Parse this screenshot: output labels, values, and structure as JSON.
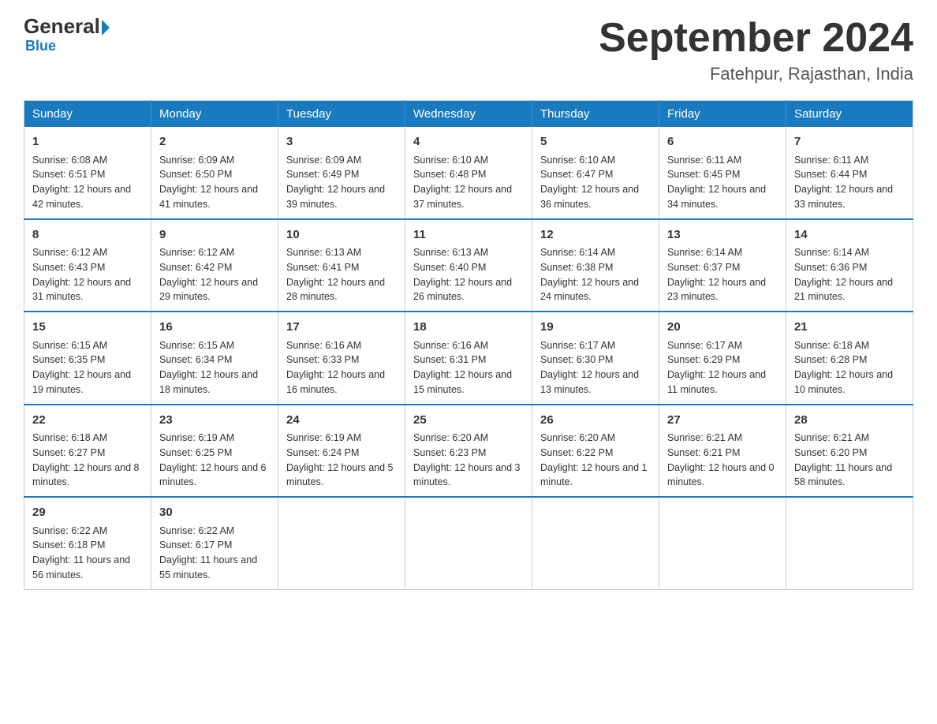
{
  "header": {
    "logo_general": "General",
    "logo_blue": "Blue",
    "month_title": "September 2024",
    "location": "Fatehpur, Rajasthan, India"
  },
  "days_header": [
    "Sunday",
    "Monday",
    "Tuesday",
    "Wednesday",
    "Thursday",
    "Friday",
    "Saturday"
  ],
  "weeks": [
    [
      {
        "day": "1",
        "sunrise": "Sunrise: 6:08 AM",
        "sunset": "Sunset: 6:51 PM",
        "daylight": "Daylight: 12 hours and 42 minutes."
      },
      {
        "day": "2",
        "sunrise": "Sunrise: 6:09 AM",
        "sunset": "Sunset: 6:50 PM",
        "daylight": "Daylight: 12 hours and 41 minutes."
      },
      {
        "day": "3",
        "sunrise": "Sunrise: 6:09 AM",
        "sunset": "Sunset: 6:49 PM",
        "daylight": "Daylight: 12 hours and 39 minutes."
      },
      {
        "day": "4",
        "sunrise": "Sunrise: 6:10 AM",
        "sunset": "Sunset: 6:48 PM",
        "daylight": "Daylight: 12 hours and 37 minutes."
      },
      {
        "day": "5",
        "sunrise": "Sunrise: 6:10 AM",
        "sunset": "Sunset: 6:47 PM",
        "daylight": "Daylight: 12 hours and 36 minutes."
      },
      {
        "day": "6",
        "sunrise": "Sunrise: 6:11 AM",
        "sunset": "Sunset: 6:45 PM",
        "daylight": "Daylight: 12 hours and 34 minutes."
      },
      {
        "day": "7",
        "sunrise": "Sunrise: 6:11 AM",
        "sunset": "Sunset: 6:44 PM",
        "daylight": "Daylight: 12 hours and 33 minutes."
      }
    ],
    [
      {
        "day": "8",
        "sunrise": "Sunrise: 6:12 AM",
        "sunset": "Sunset: 6:43 PM",
        "daylight": "Daylight: 12 hours and 31 minutes."
      },
      {
        "day": "9",
        "sunrise": "Sunrise: 6:12 AM",
        "sunset": "Sunset: 6:42 PM",
        "daylight": "Daylight: 12 hours and 29 minutes."
      },
      {
        "day": "10",
        "sunrise": "Sunrise: 6:13 AM",
        "sunset": "Sunset: 6:41 PM",
        "daylight": "Daylight: 12 hours and 28 minutes."
      },
      {
        "day": "11",
        "sunrise": "Sunrise: 6:13 AM",
        "sunset": "Sunset: 6:40 PM",
        "daylight": "Daylight: 12 hours and 26 minutes."
      },
      {
        "day": "12",
        "sunrise": "Sunrise: 6:14 AM",
        "sunset": "Sunset: 6:38 PM",
        "daylight": "Daylight: 12 hours and 24 minutes."
      },
      {
        "day": "13",
        "sunrise": "Sunrise: 6:14 AM",
        "sunset": "Sunset: 6:37 PM",
        "daylight": "Daylight: 12 hours and 23 minutes."
      },
      {
        "day": "14",
        "sunrise": "Sunrise: 6:14 AM",
        "sunset": "Sunset: 6:36 PM",
        "daylight": "Daylight: 12 hours and 21 minutes."
      }
    ],
    [
      {
        "day": "15",
        "sunrise": "Sunrise: 6:15 AM",
        "sunset": "Sunset: 6:35 PM",
        "daylight": "Daylight: 12 hours and 19 minutes."
      },
      {
        "day": "16",
        "sunrise": "Sunrise: 6:15 AM",
        "sunset": "Sunset: 6:34 PM",
        "daylight": "Daylight: 12 hours and 18 minutes."
      },
      {
        "day": "17",
        "sunrise": "Sunrise: 6:16 AM",
        "sunset": "Sunset: 6:33 PM",
        "daylight": "Daylight: 12 hours and 16 minutes."
      },
      {
        "day": "18",
        "sunrise": "Sunrise: 6:16 AM",
        "sunset": "Sunset: 6:31 PM",
        "daylight": "Daylight: 12 hours and 15 minutes."
      },
      {
        "day": "19",
        "sunrise": "Sunrise: 6:17 AM",
        "sunset": "Sunset: 6:30 PM",
        "daylight": "Daylight: 12 hours and 13 minutes."
      },
      {
        "day": "20",
        "sunrise": "Sunrise: 6:17 AM",
        "sunset": "Sunset: 6:29 PM",
        "daylight": "Daylight: 12 hours and 11 minutes."
      },
      {
        "day": "21",
        "sunrise": "Sunrise: 6:18 AM",
        "sunset": "Sunset: 6:28 PM",
        "daylight": "Daylight: 12 hours and 10 minutes."
      }
    ],
    [
      {
        "day": "22",
        "sunrise": "Sunrise: 6:18 AM",
        "sunset": "Sunset: 6:27 PM",
        "daylight": "Daylight: 12 hours and 8 minutes."
      },
      {
        "day": "23",
        "sunrise": "Sunrise: 6:19 AM",
        "sunset": "Sunset: 6:25 PM",
        "daylight": "Daylight: 12 hours and 6 minutes."
      },
      {
        "day": "24",
        "sunrise": "Sunrise: 6:19 AM",
        "sunset": "Sunset: 6:24 PM",
        "daylight": "Daylight: 12 hours and 5 minutes."
      },
      {
        "day": "25",
        "sunrise": "Sunrise: 6:20 AM",
        "sunset": "Sunset: 6:23 PM",
        "daylight": "Daylight: 12 hours and 3 minutes."
      },
      {
        "day": "26",
        "sunrise": "Sunrise: 6:20 AM",
        "sunset": "Sunset: 6:22 PM",
        "daylight": "Daylight: 12 hours and 1 minute."
      },
      {
        "day": "27",
        "sunrise": "Sunrise: 6:21 AM",
        "sunset": "Sunset: 6:21 PM",
        "daylight": "Daylight: 12 hours and 0 minutes."
      },
      {
        "day": "28",
        "sunrise": "Sunrise: 6:21 AM",
        "sunset": "Sunset: 6:20 PM",
        "daylight": "Daylight: 11 hours and 58 minutes."
      }
    ],
    [
      {
        "day": "29",
        "sunrise": "Sunrise: 6:22 AM",
        "sunset": "Sunset: 6:18 PM",
        "daylight": "Daylight: 11 hours and 56 minutes."
      },
      {
        "day": "30",
        "sunrise": "Sunrise: 6:22 AM",
        "sunset": "Sunset: 6:17 PM",
        "daylight": "Daylight: 11 hours and 55 minutes."
      },
      {
        "day": "",
        "sunrise": "",
        "sunset": "",
        "daylight": ""
      },
      {
        "day": "",
        "sunrise": "",
        "sunset": "",
        "daylight": ""
      },
      {
        "day": "",
        "sunrise": "",
        "sunset": "",
        "daylight": ""
      },
      {
        "day": "",
        "sunrise": "",
        "sunset": "",
        "daylight": ""
      },
      {
        "day": "",
        "sunrise": "",
        "sunset": "",
        "daylight": ""
      }
    ]
  ]
}
